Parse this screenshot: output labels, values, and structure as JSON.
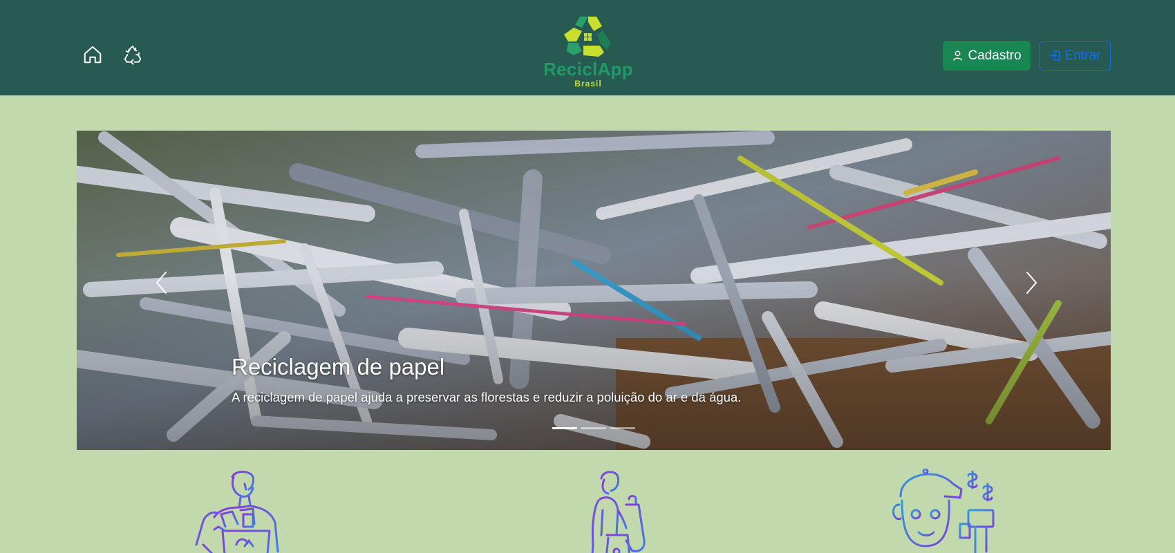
{
  "header": {
    "home_icon": "house-icon",
    "recycle_icon": "recycle-icon",
    "logo": {
      "title": "ReciclApp",
      "subtitle": "Brasil"
    },
    "cadastro_label": "Cadastro",
    "entrar_label": "Entrar"
  },
  "carousel": {
    "slides": [
      {
        "title": "Reciclagem de papel",
        "text": "A reciclagem de papel ajuda a preservar as florestas e reduzir a poluição do ar e da água."
      }
    ],
    "active_index": 0,
    "indicator_count": 3,
    "prev_icon": "chevron-left-icon",
    "next_icon": "chevron-right-icon"
  },
  "features": [
    {
      "icon": "person-with-recycling-box-icon"
    },
    {
      "icon": "person-carrying-bags-icon"
    },
    {
      "icon": "robot-with-cash-register-icon"
    }
  ],
  "colors": {
    "navbar": "#275b52",
    "page_background": "#c1d9ad",
    "cadastro_button": "#198754",
    "entrar_button": "#0d6efd",
    "illustration_gradient_start": "#8c3ad6",
    "illustration_gradient_end": "#3d7de8"
  }
}
